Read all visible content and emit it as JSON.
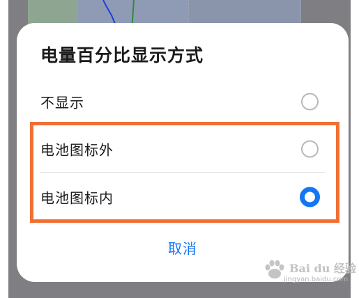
{
  "dialog": {
    "title": "电量百分比显示方式",
    "options": [
      {
        "label": "不显示",
        "selected": false
      },
      {
        "label": "电池图标外",
        "selected": false
      },
      {
        "label": "电池图标内",
        "selected": true
      }
    ],
    "cancel_label": "取消"
  },
  "colors": {
    "accent": "#1476f2",
    "highlight": "#f07034",
    "overlay": "#7f7f83",
    "dialog_bg": "#ffffff"
  },
  "watermark": {
    "brand": "Bai du 经验",
    "url": "jingyan.baidu.com"
  }
}
